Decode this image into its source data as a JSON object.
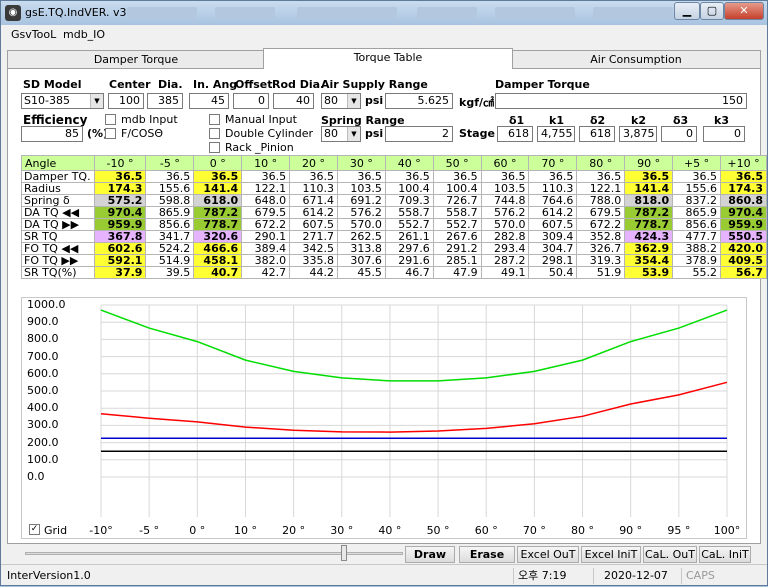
{
  "window": {
    "title": "gsE.TQ.IndVER. v3.2",
    "icon": "app-icon"
  },
  "menu": [
    "GsvTooL",
    "mdb_IO"
  ],
  "tabs": [
    "Damper Torque",
    "Torque Table",
    "Air Consumption"
  ],
  "form": {
    "sd_model_label": "SD Model",
    "sd_model_value": "S10-385",
    "center_label": "Center",
    "center_value": "100",
    "dia_label": "Dia.",
    "dia_value": "385",
    "in_ang_label": "In. Ang",
    "in_ang_value": "45",
    "offset_label": "Offset",
    "offset_value": "0",
    "rod_dia_label": "Rod Dia.",
    "rod_dia_value": "40",
    "air_supply_label": "Air Supply Range",
    "air_supply_psi": "80",
    "psi_label": "psi",
    "air_supply_value": "5.625",
    "kgf_unit": "kgf/㎠",
    "damper_torque_label": "Damper Torque",
    "damper_torque_value": "150",
    "efficiency_label": "Efficiency",
    "efficiency_value": "85",
    "percent": "(%)",
    "mdb_input": "mdb Input",
    "fcos": "F/COSΘ",
    "manual_input": "Manual Input",
    "double_cylinder": "Double Cylinder",
    "rack_pinion": "Rack _Pinion",
    "spring_range_label": "Spring Range",
    "spring_psi": "80",
    "spring_psi_label": "psi",
    "spring_value": "2",
    "stage_label": "Stage",
    "stage_headers": [
      "δ1",
      "k1",
      "δ2",
      "k2",
      "δ3",
      "k3"
    ],
    "stage_values": [
      "618",
      "4,755",
      "618",
      "3,875",
      "0",
      "0"
    ]
  },
  "table": {
    "angles": [
      "Angle",
      "-10 °",
      "-5 °",
      "0 °",
      "10 °",
      "20 °",
      "30 °",
      "40 °",
      "50 °",
      "60 °",
      "70 °",
      "80 °",
      "90 °",
      "+5 °",
      "+10 °"
    ],
    "rows": [
      {
        "label": "Damper TQ.",
        "values": [
          "36.5",
          "36.5",
          "36.5",
          "36.5",
          "36.5",
          "36.5",
          "36.5",
          "36.5",
          "36.5",
          "36.5",
          "36.5",
          "36.5",
          "36.5",
          "36.5"
        ],
        "hl": [
          "y",
          "",
          "y",
          "",
          "",
          "",
          "",
          "",
          "",
          "",
          "",
          "y",
          "",
          "y"
        ]
      },
      {
        "label": "Radius",
        "values": [
          "174.3",
          "155.6",
          "141.4",
          "122.1",
          "110.3",
          "103.5",
          "100.4",
          "100.4",
          "103.5",
          "110.3",
          "122.1",
          "141.4",
          "155.6",
          "174.3"
        ],
        "hl": [
          "y",
          "",
          "y",
          "",
          "",
          "",
          "",
          "",
          "",
          "",
          "",
          "y",
          "",
          "y"
        ]
      },
      {
        "label": "Spring δ",
        "values": [
          "575.2",
          "598.8",
          "618.0",
          "648.0",
          "671.4",
          "691.2",
          "709.3",
          "726.7",
          "744.8",
          "764.6",
          "788.0",
          "818.0",
          "837.2",
          "860.8"
        ],
        "hl": [
          "gr",
          "",
          "gr",
          "",
          "",
          "",
          "",
          "",
          "",
          "",
          "",
          "gr",
          "",
          "gr"
        ]
      },
      {
        "label": "DA TQ ◀◀",
        "values": [
          "970.4",
          "865.9",
          "787.2",
          "679.5",
          "614.2",
          "576.2",
          "558.7",
          "558.7",
          "576.2",
          "614.2",
          "679.5",
          "787.2",
          "865.9",
          "970.4"
        ],
        "hl": [
          "g",
          "",
          "g",
          "",
          "",
          "",
          "",
          "",
          "",
          "",
          "",
          "g",
          "",
          "g"
        ]
      },
      {
        "label": "DA TQ ▶▶",
        "values": [
          "959.9",
          "856.6",
          "778.7",
          "672.2",
          "607.5",
          "570.0",
          "552.7",
          "552.7",
          "570.0",
          "607.5",
          "672.2",
          "778.7",
          "856.6",
          "959.9"
        ],
        "hl": [
          "g",
          "",
          "g",
          "",
          "",
          "",
          "",
          "",
          "",
          "",
          "",
          "g",
          "",
          "g"
        ]
      },
      {
        "label": "SR TQ",
        "values": [
          "367.8",
          "341.7",
          "320.6",
          "290.1",
          "271.7",
          "262.5",
          "261.1",
          "267.6",
          "282.8",
          "309.4",
          "352.8",
          "424.3",
          "477.7",
          "550.5"
        ],
        "hl": [
          "p",
          "",
          "p",
          "",
          "",
          "",
          "",
          "",
          "",
          "",
          "",
          "p",
          "",
          "p"
        ]
      },
      {
        "label": "FO TQ ◀◀",
        "values": [
          "602.6",
          "524.2",
          "466.6",
          "389.4",
          "342.5",
          "313.8",
          "297.6",
          "291.2",
          "293.4",
          "304.7",
          "326.7",
          "362.9",
          "388.2",
          "420.0"
        ],
        "hl": [
          "y",
          "",
          "y",
          "",
          "",
          "",
          "",
          "",
          "",
          "",
          "",
          "y",
          "",
          "y"
        ]
      },
      {
        "label": "FO TQ ▶▶",
        "values": [
          "592.1",
          "514.9",
          "458.1",
          "382.0",
          "335.8",
          "307.6",
          "291.6",
          "285.1",
          "287.2",
          "298.1",
          "319.3",
          "354.4",
          "378.9",
          "409.5"
        ],
        "hl": [
          "y",
          "",
          "y",
          "",
          "",
          "",
          "",
          "",
          "",
          "",
          "",
          "y",
          "",
          "y"
        ]
      },
      {
        "label": "SR TQ(%)",
        "values": [
          "37.9",
          "39.5",
          "40.7",
          "42.7",
          "44.2",
          "45.5",
          "46.7",
          "47.9",
          "49.1",
          "50.4",
          "51.9",
          "53.9",
          "55.2",
          "56.7"
        ],
        "hl": [
          "y",
          "",
          "y",
          "",
          "",
          "",
          "",
          "",
          "",
          "",
          "",
          "y",
          "",
          "y"
        ]
      }
    ]
  },
  "chart_data": {
    "type": "line",
    "x_labels": [
      "-10°",
      "-5 °",
      "0 °",
      "10 °",
      "20 °",
      "30 °",
      "40 °",
      "50 °",
      "60 °",
      "70 °",
      "80 °",
      "90 °",
      "95 °",
      "100°"
    ],
    "y_labels": [
      "1000.0",
      "900.0",
      "800.0",
      "700.0",
      "600.0",
      "500.0",
      "400.0",
      "300.0",
      "200.0",
      "100.0",
      "0.0"
    ],
    "ylim": [
      0,
      1000
    ],
    "grid": true,
    "series": [
      {
        "color": "#00dd00",
        "values": [
          970.4,
          865.9,
          787.2,
          679.5,
          614.2,
          576.2,
          558.7,
          558.7,
          576.2,
          614.2,
          679.5,
          787.2,
          865.9,
          970.4
        ]
      },
      {
        "color": "#ff0000",
        "values": [
          367.8,
          341.7,
          320.6,
          290.1,
          271.7,
          262.5,
          261.1,
          267.6,
          282.8,
          309.4,
          352.8,
          424.3,
          477.7,
          550.5
        ]
      },
      {
        "color": "#0000cc",
        "values": [
          225,
          225,
          225,
          225,
          225,
          225,
          225,
          225,
          225,
          225,
          225,
          225,
          225,
          225
        ]
      },
      {
        "color": "#000000",
        "values": [
          150,
          150,
          150,
          150,
          150,
          150,
          150,
          150,
          150,
          150,
          150,
          150,
          150,
          150
        ]
      }
    ]
  },
  "grid_checkbox_label": "Grid",
  "buttons": [
    "Draw",
    "Erase",
    "Excel OuT",
    "Excel IniT",
    "CaL. OuT",
    "CaL. IniT"
  ],
  "status": {
    "version": "InterVersion1.0",
    "time": "오후 7:19",
    "date": "2020-12-07",
    "caps": "CAPS"
  }
}
